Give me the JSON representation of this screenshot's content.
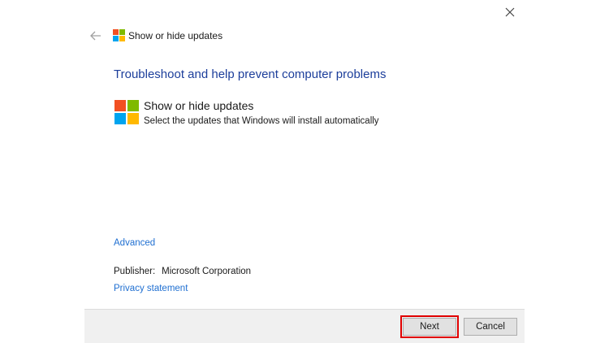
{
  "dialog": {
    "title": "Show or hide updates",
    "close_icon": "close-icon",
    "back_icon": "back-arrow-icon"
  },
  "main": {
    "heading": "Troubleshoot and help prevent computer problems",
    "item_title": "Show or hide updates",
    "item_description": "Select the updates that Windows will install automatically",
    "advanced_link": "Advanced",
    "publisher_label": "Publisher:",
    "publisher_value": "Microsoft Corporation",
    "privacy_link": "Privacy statement"
  },
  "footer": {
    "next_label": "Next",
    "cancel_label": "Cancel"
  },
  "colors": {
    "heading": "#1c3e9b",
    "link": "#1f6fd1",
    "highlight": "#e00000",
    "logo_red": "#f25022",
    "logo_green": "#7fba00",
    "logo_blue": "#00a4ef",
    "logo_yellow": "#ffb900"
  }
}
